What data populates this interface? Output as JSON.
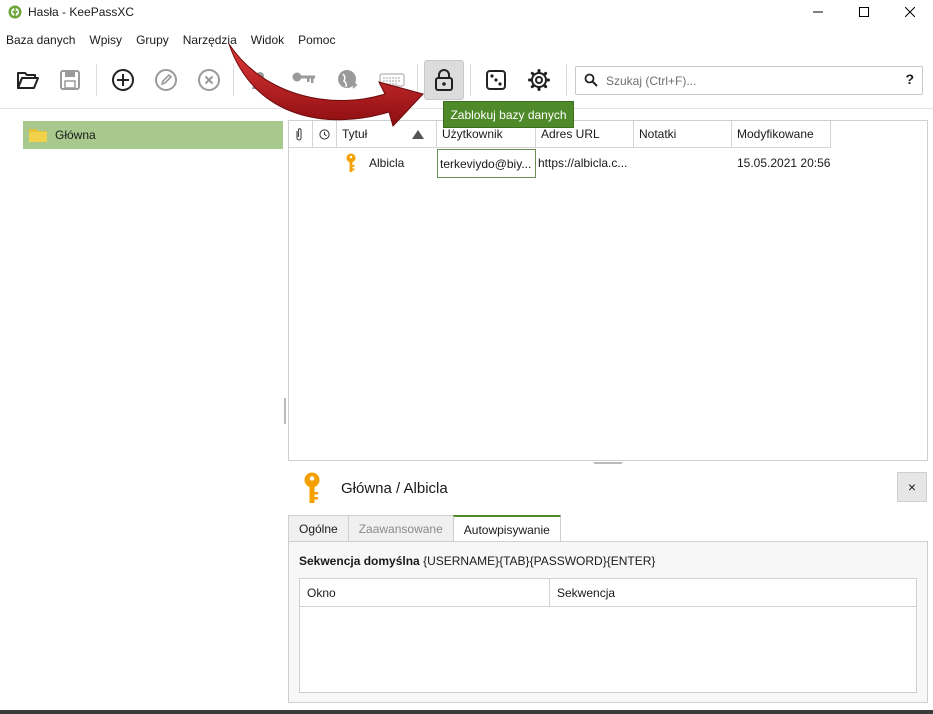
{
  "window": {
    "title": "Hasła - KeePassXC",
    "controls": [
      "minimize-icon",
      "maximize-icon",
      "close-icon"
    ]
  },
  "menu": [
    "Baza danych",
    "Wpisy",
    "Grupy",
    "Narzędzia",
    "Widok",
    "Pomoc"
  ],
  "toolbar": {
    "buttons": [
      {
        "name": "open-database",
        "icon": "folder-open-icon"
      },
      {
        "name": "save-database",
        "icon": "save-icon"
      },
      {
        "name": "add-entry",
        "icon": "add-icon"
      },
      {
        "name": "edit-entry",
        "icon": "edit-icon"
      },
      {
        "name": "delete-entry",
        "icon": "delete-icon"
      },
      {
        "name": "copy-username",
        "icon": "user-icon"
      },
      {
        "name": "copy-password",
        "icon": "key-icon"
      },
      {
        "name": "copy-url",
        "icon": "globe-icon"
      },
      {
        "name": "autotype",
        "icon": "keyboard-icon"
      },
      {
        "name": "lock-database",
        "icon": "lock-icon",
        "active": true
      },
      {
        "name": "password-generator",
        "icon": "dice-icon"
      },
      {
        "name": "settings",
        "icon": "gear-icon"
      }
    ],
    "tooltip": "Zablokuj bazy danych"
  },
  "search": {
    "placeholder": "Szukaj (Ctrl+F)...",
    "value": "",
    "help": "?"
  },
  "groups": {
    "items": [
      {
        "label": "Główna",
        "selected": true
      }
    ]
  },
  "entries": {
    "columns": [
      "",
      "",
      "Tytuł",
      "Użytkownik",
      "Adres URL",
      "Notatki",
      "Modyfikowane"
    ],
    "sort_column": "Tytuł",
    "sort_direction": "ascending",
    "rows": [
      {
        "title": "Albicla",
        "username": "terkeviydo@biy...",
        "url": "https://albicla.c...",
        "notes": "",
        "modified": "15.05.2021 20:56"
      }
    ]
  },
  "details": {
    "title": "Główna / Albicla",
    "close": "×",
    "tabs": [
      {
        "label": "Ogólne",
        "state": "normal"
      },
      {
        "label": "Zaawansowane",
        "state": "disabled"
      },
      {
        "label": "Autowpisywanie",
        "state": "active"
      }
    ],
    "autotype": {
      "default_sequence_label": "Sekwencja domyślna",
      "default_sequence": "{USERNAME}{TAB}{PASSWORD}{ENTER}",
      "columns": [
        "Okno",
        "Sekwencja"
      ]
    }
  },
  "colors": {
    "accent": "#4f8a2a",
    "selection": "#a8c98e",
    "key": "#f5a000",
    "arrow": "#c4141a"
  }
}
